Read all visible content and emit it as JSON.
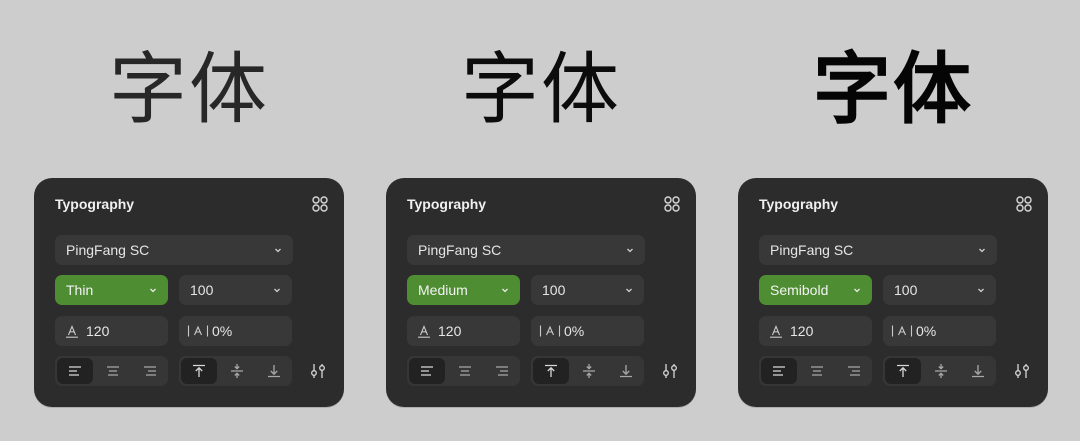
{
  "panels": [
    {
      "sample_text": "字体",
      "title": "Typography",
      "font_family": "PingFang SC",
      "weight": "Thin",
      "size": "100",
      "line_height": "120",
      "letter_spacing": "0%",
      "accent_color": "#4f8d32"
    },
    {
      "sample_text": "字体",
      "title": "Typography",
      "font_family": "PingFang SC",
      "weight": "Medium",
      "size": "100",
      "line_height": "120",
      "letter_spacing": "0%",
      "accent_color": "#4f8d32"
    },
    {
      "sample_text": "字体",
      "title": "Typography",
      "font_family": "PingFang SC",
      "weight": "Semibold",
      "size": "100",
      "line_height": "120",
      "letter_spacing": "0%",
      "accent_color": "#4f8d32"
    }
  ],
  "icons": {
    "menu": "four-dots-icon",
    "dropdown": "chevron-down-icon",
    "line_height": "line-height-icon",
    "letter_spacing": "letter-spacing-icon",
    "align_left": "align-left-icon",
    "align_center": "align-center-icon",
    "align_right": "align-right-icon",
    "valign_top": "align-top-icon",
    "valign_middle": "align-middle-icon",
    "valign_bottom": "align-bottom-icon",
    "advanced": "sliders-icon"
  }
}
